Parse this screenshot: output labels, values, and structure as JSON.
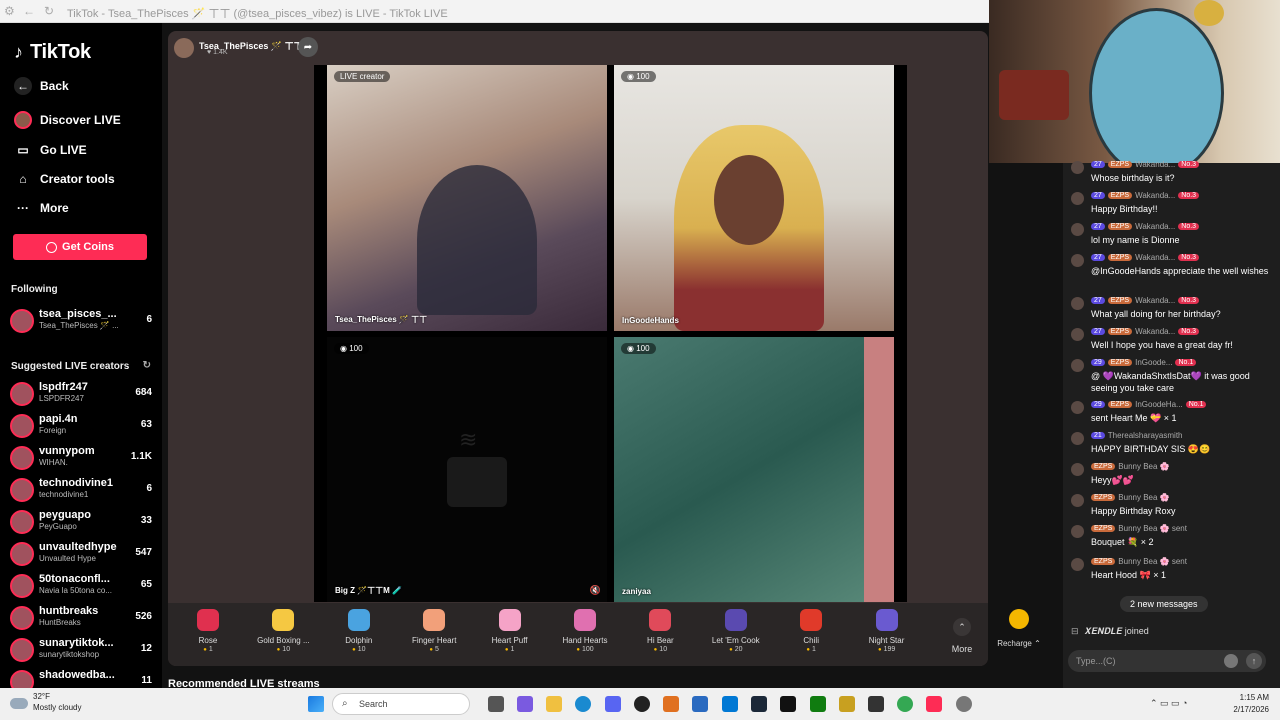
{
  "browser": {
    "tab_title": "TikTok - Tsea_ThePisces 🪄 ㄒㄒ (@tsea_pisces_vibez) is LIVE - TikTok LIVE"
  },
  "sidebar": {
    "logo": "TikTok",
    "nav": [
      {
        "label": "Back",
        "icon": "back-arrow-icon"
      },
      {
        "label": "Discover LIVE",
        "icon": "live-avatar-icon"
      },
      {
        "label": "Go LIVE",
        "icon": "camera-icon"
      },
      {
        "label": "Creator tools",
        "icon": "home-icon"
      },
      {
        "label": "More",
        "icon": "ellipsis-icon"
      }
    ],
    "get_coins": "Get Coins",
    "following_title": "Following",
    "following": [
      {
        "name": "tsea_pisces_...",
        "sub": "Tsea_ThePisces 🪄 ...",
        "count": "6"
      }
    ],
    "suggested_title": "Suggested LIVE creators",
    "suggested": [
      {
        "name": "lspdfr247",
        "sub": "LSPDFR247",
        "count": "684"
      },
      {
        "name": "papi.4n",
        "sub": "Foreign",
        "count": "63"
      },
      {
        "name": "vunnypom",
        "sub": "WIHAN.",
        "count": "1.1K"
      },
      {
        "name": "technodivine1",
        "sub": "technodivine1",
        "count": "6"
      },
      {
        "name": "peyguapo",
        "sub": "PeyGuapo",
        "count": "33"
      },
      {
        "name": "unvaultedhype",
        "sub": "Unvaulted Hype",
        "count": "547"
      },
      {
        "name": "50tonaconfl...",
        "sub": "Navia la 50tona co...",
        "count": "65"
      },
      {
        "name": "huntbreaks",
        "sub": "HuntBreaks",
        "count": "526"
      },
      {
        "name": "sunarytiktok...",
        "sub": "sunarytiktokshop",
        "count": "12"
      },
      {
        "name": "shadowedba...",
        "sub": "",
        "count": "11"
      }
    ]
  },
  "stream": {
    "host_name": "Tsea_ThePisces 🪄 ㄒㄒ",
    "host_likes": "1.4K",
    "tiles": [
      {
        "tag": "LIVE creator",
        "name": "Tsea_ThePisces 🪄 ㄒㄒ"
      },
      {
        "tag": "100",
        "name": "InGoodeHands"
      },
      {
        "tag": "100",
        "name": "Big Z 🪄ㄒㄒM 🧪"
      },
      {
        "tag": "100",
        "name": "zaniyaa"
      }
    ]
  },
  "gifts": [
    {
      "name": "Rose",
      "price": "1",
      "color": "#e0304f",
      "icon": "rose-icon"
    },
    {
      "name": "Gold Boxing ...",
      "price": "10",
      "color": "#f5c842",
      "icon": "boxing-glove-icon"
    },
    {
      "name": "Dolphin",
      "price": "10",
      "color": "#4aa3e0",
      "icon": "dolphin-icon"
    },
    {
      "name": "Finger Heart",
      "price": "5",
      "color": "#f2a07a",
      "icon": "finger-heart-icon"
    },
    {
      "name": "Heart Puff",
      "price": "1",
      "color": "#f5a3c7",
      "icon": "heart-puff-icon"
    },
    {
      "name": "Hand Hearts",
      "price": "100",
      "color": "#e070b0",
      "icon": "hand-hearts-icon"
    },
    {
      "name": "Hi Bear",
      "price": "10",
      "color": "#e04a5a",
      "icon": "bear-icon"
    },
    {
      "name": "Let 'Em Cook",
      "price": "20",
      "color": "#5a4ab0",
      "icon": "cook-icon"
    },
    {
      "name": "Chili",
      "price": "1",
      "color": "#e03a2a",
      "icon": "chili-icon"
    },
    {
      "name": "Night Star",
      "price": "199",
      "color": "#6a5ad0",
      "icon": "night-star-icon"
    }
  ],
  "gift_more": "More",
  "recharge": "Recharge",
  "recommended_title": "Recommended LIVE streams",
  "chat": {
    "messages": [
      {
        "lvl": "27",
        "fan": "EZPS",
        "user": "Wakanda...",
        "rank": "No.3",
        "text": "Whose birthday is it?"
      },
      {
        "lvl": "27",
        "fan": "EZPS",
        "user": "Wakanda...",
        "rank": "No.3",
        "text": "Happy Birthday!!"
      },
      {
        "lvl": "27",
        "fan": "EZPS",
        "user": "Wakanda...",
        "rank": "No.3",
        "text": "lol my name is Dionne"
      },
      {
        "lvl": "27",
        "fan": "EZPS",
        "user": "Wakanda...",
        "rank": "No.3",
        "text": "@InGoodeHands appreciate the well wishes"
      },
      {
        "lvl": "27",
        "fan": "EZPS",
        "user": "Wakanda...",
        "rank": "No.3",
        "text": "What yall doing for her birthday?"
      },
      {
        "lvl": "27",
        "fan": "EZPS",
        "user": "Wakanda...",
        "rank": "No.3",
        "text": "Well I hope you have a great day fr!"
      },
      {
        "lvl": "29",
        "fan": "EZPS",
        "user": "InGoode...",
        "rank": "No.1",
        "text": "@ 💜WakandaShxtIsDat💜 it was good seeing you take care"
      },
      {
        "lvl": "29",
        "fan": "EZPS",
        "user": "InGoodeHa...",
        "rank": "No.1",
        "text": "sent Heart Me 💝 × 1"
      },
      {
        "lvl": "21",
        "fan": "",
        "user": "Therealsharayasmith",
        "rank": "",
        "text": "HAPPY BIRTHDAY SIS 😍😊"
      },
      {
        "lvl": "",
        "fan": "EZPS",
        "user": "Bunny Bea 🌸",
        "rank": "",
        "text": "Heyy💕💕"
      },
      {
        "lvl": "",
        "fan": "EZPS",
        "user": "Bunny Bea 🌸",
        "rank": "",
        "text": "Happy Birthday Roxy"
      },
      {
        "lvl": "",
        "fan": "EZPS",
        "user": "Bunny Bea 🌸 sent",
        "rank": "",
        "text": "Bouquet 💐 × 2"
      },
      {
        "lvl": "",
        "fan": "EZPS",
        "user": "Bunny Bea 🌸 sent",
        "rank": "",
        "text": "Heart Hood 🎀 × 1"
      }
    ],
    "new_messages": "2 new messages",
    "joined_user": "𝑿𝑬𝑵𝑫𝑳𝑬",
    "joined_text": "joined",
    "input_placeholder": "Type...(C)"
  },
  "taskbar": {
    "weather_temp": "32°F",
    "weather_desc": "Mostly cloudy",
    "search_label": "Search",
    "time": "1:15 AM",
    "date": "2/17/2026"
  }
}
